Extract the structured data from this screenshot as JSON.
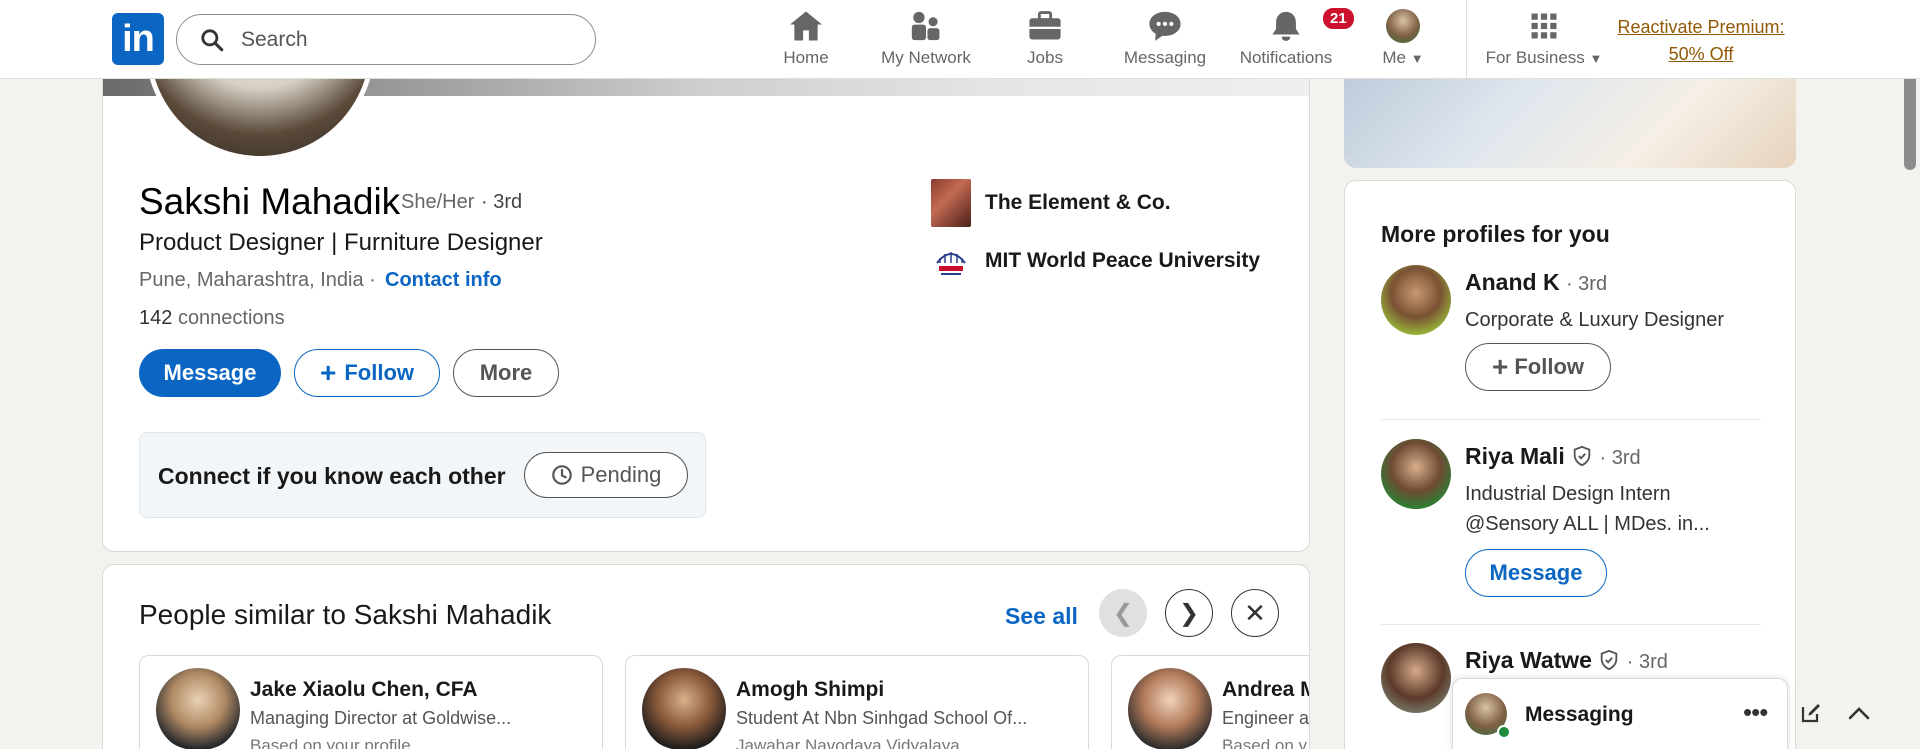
{
  "nav": {
    "logo_text": "in",
    "search_placeholder": "Search",
    "items": [
      {
        "label": "Home"
      },
      {
        "label": "My Network"
      },
      {
        "label": "Jobs"
      },
      {
        "label": "Messaging"
      },
      {
        "label": "Notifications",
        "badge": "21"
      },
      {
        "label": "Me"
      },
      {
        "label": "For Business"
      }
    ],
    "premium_line1": "Reactivate Premium:",
    "premium_line2": "50% Off"
  },
  "profile": {
    "name": "Sakshi Mahadik",
    "pronouns": "She/Her",
    "degree": "· 3rd",
    "headline": "Product Designer | Furniture Designer",
    "location": "Pune, Maharashtra, India ·",
    "contact_info": "Contact info",
    "connections_count": "142",
    "connections_label": "connections",
    "buttons": {
      "message": "Message",
      "follow": "Follow",
      "more": "More"
    },
    "connect_prompt": "Connect if you know each other",
    "pending_label": "Pending",
    "experience": [
      {
        "label": "The Element & Co."
      },
      {
        "label": "MIT World Peace University"
      }
    ]
  },
  "similar": {
    "title": "People similar to Sakshi Mahadik",
    "see_all": "See all",
    "people": [
      {
        "name": "Jake Xiaolu Chen, CFA",
        "headline": "Managing Director at Goldwise...",
        "sub": "Based on your profile"
      },
      {
        "name": "Amogh Shimpi",
        "headline": "Student At Nbn Sinhgad School Of...",
        "sub": "Jawahar Navodaya Vidyalaya"
      },
      {
        "name": "Andrea M",
        "headline": "Engineer a",
        "sub": "Based on y"
      }
    ]
  },
  "more_profiles": {
    "title": "More profiles for you",
    "people": [
      {
        "name": "Anand K",
        "degree": "· 3rd",
        "headline": "Corporate & Luxury Designer",
        "button": "Follow"
      },
      {
        "name": "Riya Mali",
        "degree": "· 3rd",
        "headline_line1": "Industrial Design Intern",
        "headline_line2": "@Sensory ALL | MDes. in...",
        "button": "Message"
      },
      {
        "name": "Riya Watwe",
        "degree": "· 3rd"
      }
    ]
  },
  "messaging": {
    "label": "Messaging"
  },
  "colors": {
    "brand": "#0a66c2",
    "badge": "#cb112d",
    "premium": "#915907"
  }
}
